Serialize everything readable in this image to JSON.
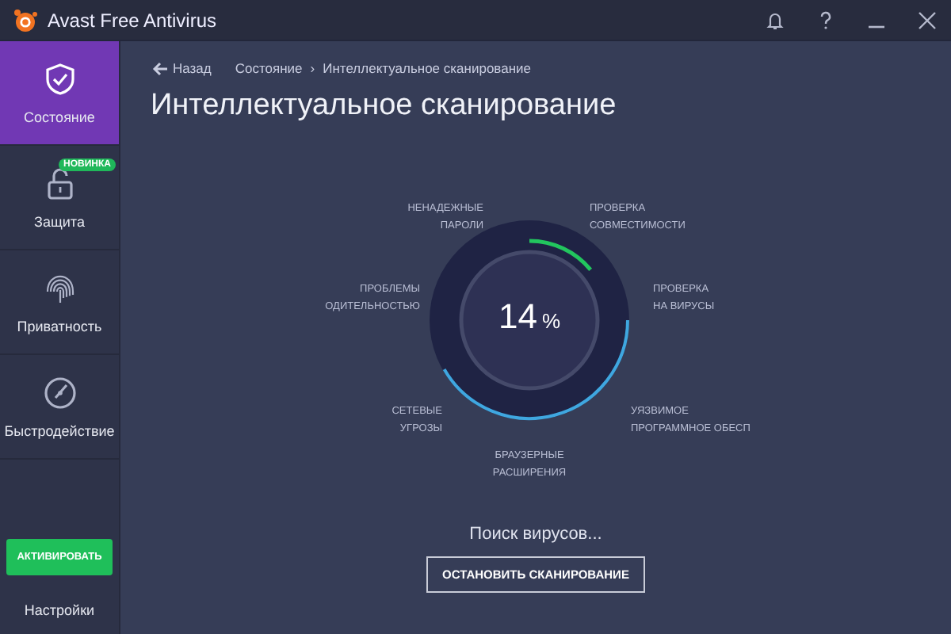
{
  "window": {
    "title": "Avast Free Antivirus"
  },
  "sidebar": {
    "items": [
      {
        "label": "Состояние",
        "selected": true
      },
      {
        "label": "Защита",
        "selected": false,
        "badge": "НОВИНКА"
      },
      {
        "label": "Приватность",
        "selected": false
      },
      {
        "label": "Быстродействие",
        "selected": false
      }
    ],
    "activate_button": "АКТИВИРОВАТЬ",
    "settings": "Настройки"
  },
  "breadcrumb": {
    "back": "Назад",
    "separator": "›",
    "items": [
      "Состояние",
      "Интеллектуальное сканирование"
    ]
  },
  "heading": "Интеллектуальное сканирование",
  "scan": {
    "percent": "14",
    "unit": "%",
    "level": 0.14,
    "labels": [
      "НЕНАДЕЖНЫЕ\nПАРОЛИ",
      "ПРОВЕРКА\nСОВМЕСТИМОСТИ",
      "ПРОБЛЕМЫ\nОДИТЕЛЬНОСТЬЮ",
      "ПРОВЕРКА\nНА ВИРУСЫ",
      "СЕТЕВЫЕ\nУГРОЗЫ",
      "УЯЗВИМОЕ\nПРОГРАММНОЕ ОБЕСП",
      "БРАУЗЕРНЫЕ\nРАСШИРЕНИЯ"
    ],
    "status": "Поиск вирусов...",
    "stop_button": "ОСТАНОВИТЬ СКАНИРОВАНИЕ"
  }
}
